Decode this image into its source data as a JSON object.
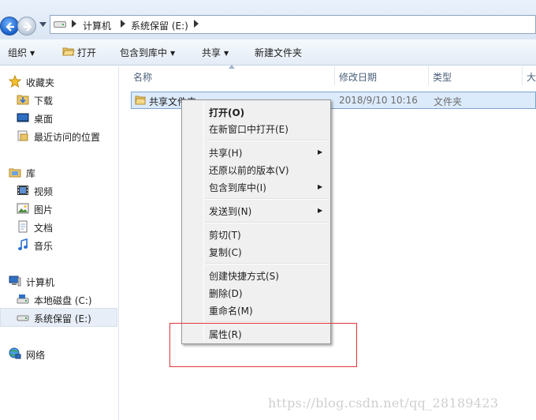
{
  "address": {
    "crumbs": [
      "计算机",
      "系统保留 (E:)"
    ]
  },
  "toolbar": {
    "organize": "组织",
    "open": "打开",
    "include_in_library": "包含到库中",
    "share": "共享",
    "new_folder": "新建文件夹"
  },
  "nav": {
    "favorites": "收藏夹",
    "downloads": "下载",
    "desktop": "桌面",
    "recent": "最近访问的位置",
    "libraries": "库",
    "videos": "视频",
    "pictures": "图片",
    "documents": "文档",
    "music": "音乐",
    "computer": "计算机",
    "local_disk": "本地磁盘 (C:)",
    "system_reserved": "系统保留 (E:)",
    "network": "网络"
  },
  "columns": {
    "name": "名称",
    "date": "修改日期",
    "type": "类型",
    "size": "大"
  },
  "file": {
    "name": "共享文件夹",
    "date": "2018/9/10 10:16",
    "type": "文件夹"
  },
  "menu": {
    "open": "打开(O)",
    "open_new_window": "在新窗口中打开(E)",
    "share_with": "共享(H)",
    "restore_versions": "还原以前的版本(V)",
    "include_library": "包含到库中(I)",
    "send_to": "发送到(N)",
    "cut": "剪切(T)",
    "copy": "复制(C)",
    "create_shortcut": "创建快捷方式(S)",
    "delete": "删除(D)",
    "rename": "重命名(M)",
    "properties": "属性(R)"
  },
  "watermark": "https://blog.csdn.net/qq_28189423",
  "colors": {
    "accent_blue": "#1a5fc8",
    "selection_bg": "#dcebfc",
    "highlight_red": "#e0363a"
  }
}
